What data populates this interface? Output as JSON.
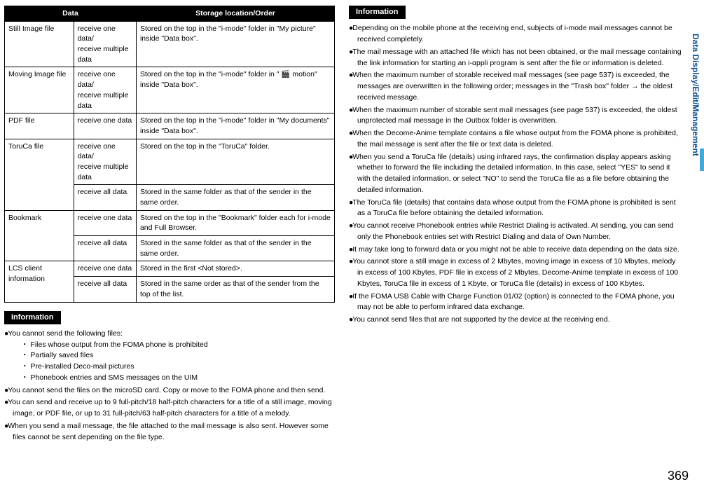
{
  "table": {
    "headers": [
      "Data",
      "",
      "Storage location/Order"
    ],
    "rows": [
      {
        "c0": "Still Image file",
        "c1": "receive one data/\nreceive multiple data",
        "c2": "Stored on the top in the \"i-mode\" folder in \"My picture\" inside \"Data box\"."
      },
      {
        "c0": "Moving Image file",
        "c1": "receive one data/\nreceive multiple data",
        "c2": "Stored on the top in the \"i-mode\" folder in \" 🎬 motion\" inside \"Data box\"."
      },
      {
        "c0": "PDF file",
        "c1": "receive one data",
        "c2": "Stored on the top in the \"i-mode\" folder in \"My documents\" inside \"Data box\"."
      },
      {
        "c0": "ToruCa file",
        "c1a": "receive one data/\nreceive multiple data",
        "c2a": "Stored on the top in the \"ToruCa\" folder.",
        "c1b": "receive all data",
        "c2b": "Stored in the same folder as that of the sender in the same order."
      },
      {
        "c0": "Bookmark",
        "c1a": "receive one data",
        "c2a": "Stored on the top in the \"Bookmark\" folder each for i-mode and Full Browser.",
        "c1b": "receive all data",
        "c2b": "Stored in the same folder as that of the sender in the same order."
      },
      {
        "c0": "LCS client information",
        "c1a": "receive one data",
        "c2a": "Stored in the first <Not stored>.",
        "c1b": "receive all data",
        "c2b": "Stored in the same order as that of the sender from the top of the list."
      }
    ]
  },
  "infoLabel": "Information",
  "leftInfo": {
    "item0": "You cannot send the following files:",
    "sub": [
      "Files whose output from the FOMA phone is prohibited",
      "Partially saved files",
      "Pre-installed Deco-mail pictures",
      "Phonebook entries and SMS messages on the UIM"
    ],
    "item1": "You cannot send the files on the microSD card. Copy or move to the FOMA phone and then send.",
    "item2": "You can send and receive up to 9 full-pitch/18 half-pitch characters for a title of a still image, moving image, or PDF file, or up to 31 full-pitch/63 half-pitch characters for a title of a melody.",
    "item3": "When you send a mail message, the file attached to the mail message is also sent. However some files cannot be sent depending on the file type."
  },
  "rightInfo": [
    "Depending on the mobile phone at the receiving end, subjects of i-mode mail messages cannot be received completely.",
    "The mail message with an attached file which has not been obtained, or the mail message containing the link information for starting an i-αppli program is sent after the file or information is deleted.",
    "When the maximum number of storable received mail messages (see page 537) is exceeded, the messages are overwritten in the following order; messages in the \"Trash box\" folder → the oldest received message.",
    "When the maximum number of storable sent mail messages (see page 537) is exceeded, the oldest unprotected mail message in the Outbox folder is overwritten.",
    "When the Decome-Anime template contains a file whose output from the FOMA phone is prohibited, the mail message is sent after the file or text data is deleted.",
    "When you send a ToruCa file (details) using infrared rays, the confirmation display appears asking whether to forward the file including the detailed information. In this case, select \"YES\" to send it with the detailed information, or select \"NO\" to send the ToruCa file as a file before obtaining the detailed information.",
    "The ToruCa file (details) that contains data whose output from the FOMA phone is prohibited is sent as a ToruCa file before obtaining the detailed information.",
    "You cannot receive Phonebook entries while Restrict Dialing is activated. At sending, you can send only the Phonebook entries set with Restrict Dialing and data of Own Number.",
    "It may take long to forward data or you might not be able to receive data depending on the data size.",
    "You cannot store a still image in excess of 2 Mbytes, moving image in excess of 10 Mbytes, melody in excess of 100 Kbytes, PDF file in excess of 2 Mbytes, Decome-Anime template in excess of 100 Kbytes, ToruCa file in excess of 1 Kbyte, or ToruCa file (details) in excess of 100 Kbytes.",
    "If the FOMA USB Cable with Charge Function 01/02 (option) is connected to the FOMA phone, you may not be able to perform infrared data exchange.",
    "You cannot send files that are not supported by the device at the receiving end."
  ],
  "sideTab": "Data Display/Edit/Management",
  "pageNum": "369"
}
